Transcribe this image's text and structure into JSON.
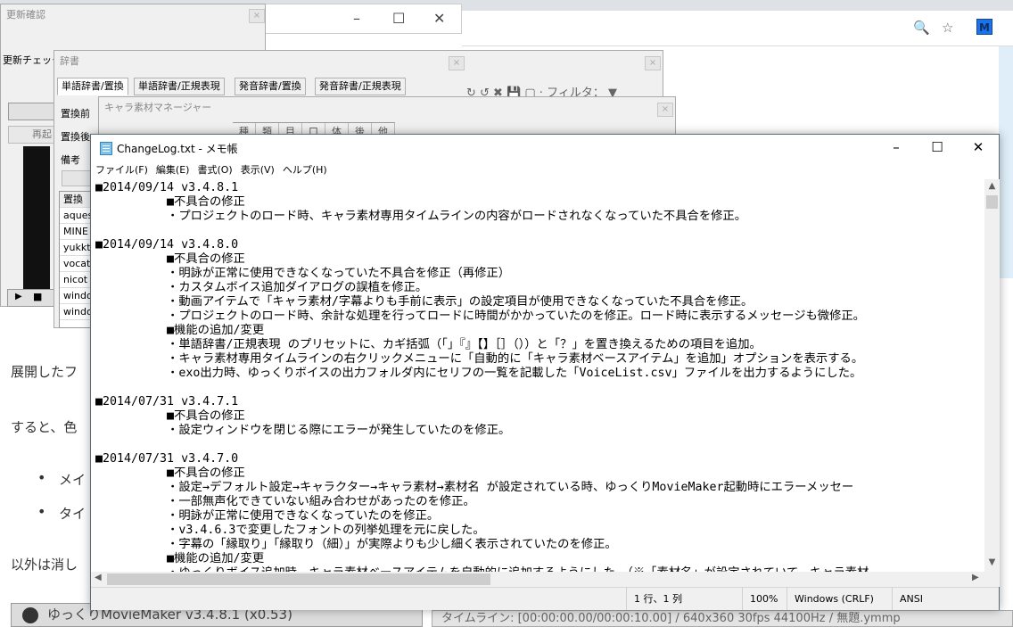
{
  "browser": {
    "controls": [
      "🔍",
      "☆"
    ],
    "extension": "M"
  },
  "web_page": {
    "para1": "展開したフ",
    "para2": "すると、色",
    "bullets": [
      "メイ",
      "タイ"
    ],
    "para3": "以外は消し"
  },
  "update_window": {
    "title": "更新確認",
    "label": "更新チェック",
    "button": "再起"
  },
  "dictionary_window": {
    "title": "辞書",
    "tabs": [
      "単語辞書/置換",
      "単語辞書/正規表現",
      "発音辞書/置換",
      "発音辞書/正規表現"
    ],
    "labels": [
      "置換前",
      "置換後",
      "備考"
    ],
    "list_header": "置換",
    "list_items": [
      "aques",
      "MINE",
      "yukkt",
      "vocat",
      "nicot",
      "windo",
      "windo"
    ],
    "toolbar_filter": "フィルタ："
  },
  "chara_window": {
    "title": "キャラ素材マネージャー",
    "columns": [
      "種",
      "類",
      "目",
      "口",
      "体",
      "後",
      "他"
    ]
  },
  "notepad": {
    "title": "ChangeLog.txt - メモ帳",
    "menu": [
      "ファイル(F)",
      "編集(E)",
      "書式(O)",
      "表示(V)",
      "ヘルプ(H)"
    ],
    "lines": [
      "■2014/09/14 v3.4.8.1",
      "          ■不具合の修正",
      "          ・プロジェクトのロード時、キャラ素材専用タイムラインの内容がロードされなくなっていた不具合を修正。",
      "",
      "■2014/09/14 v3.4.8.0",
      "          ■不具合の修正",
      "          ・明詠が正常に使用できなくなっていた不具合を修正（再修正）",
      "          ・カスタムボイス追加ダイアログの誤植を修正。",
      "          ・動画アイテムで「キャラ素材/字幕よりも手前に表示」の設定項目が使用できなくなっていた不具合を修正。",
      "          ・プロジェクトのロード時、余計な処理を行ってロードに時間がかかっていたのを修正。ロード時に表示するメッセージも微修正。",
      "          ■機能の追加/変更",
      "          ・単語辞書/正規表現 のプリセットに、カギ括弧（「」『』【】［］（））と「？」を置き換えるための項目を追加。",
      "          ・キャラ素材専用タイムラインの右クリックメニューに「自動的に「キャラ素材ベースアイテム」を追加」オプションを表示する。",
      "          ・exo出力時、ゆっくりボイスの出力フォルダ内にセリフの一覧を記載した「VoiceList.csv」ファイルを出力するようにした。",
      "",
      "■2014/07/31 v3.4.7.1",
      "          ■不具合の修正",
      "          ・設定ウィンドウを閉じる際にエラーが発生していたのを修正。",
      "",
      "■2014/07/31 v3.4.7.0",
      "          ■不具合の修正",
      "          ・設定→デフォルト設定→キャラクター→キャラ素材→素材名 が設定されている時、ゆっくりMovieMaker起動時にエラーメッセー",
      "          ・一部無声化できていない組み合わせがあったのを修正。",
      "          ・明詠が正常に使用できなくなっていたのを修正。",
      "          ・v3.4.6.3で変更したフォントの列挙処理を元に戻した。",
      "          ・字幕の「縁取り」「縁取り（細）」が実際よりも少し細く表示されていたのを修正。",
      "          ■機能の追加/変更",
      "          ・ゆっくりボイス追加時、キャラ素材ベースアイテムを自動的に追加するようにした。（※「素材名」が設定されていて、キャラ素材"
    ],
    "status": {
      "position": "1 行、1 列",
      "zoom": "100%",
      "line_ending": "Windows (CRLF)",
      "encoding": "ANSI"
    }
  },
  "taskbar": {
    "main_window": "ゆっくりMovieMaker v3.4.8.1 (x0.53)",
    "timeline": "タイムライン: [00:00:00.00/00:00:10.00] / 640x360 30fps 44100Hz / 無題.ymmp"
  }
}
